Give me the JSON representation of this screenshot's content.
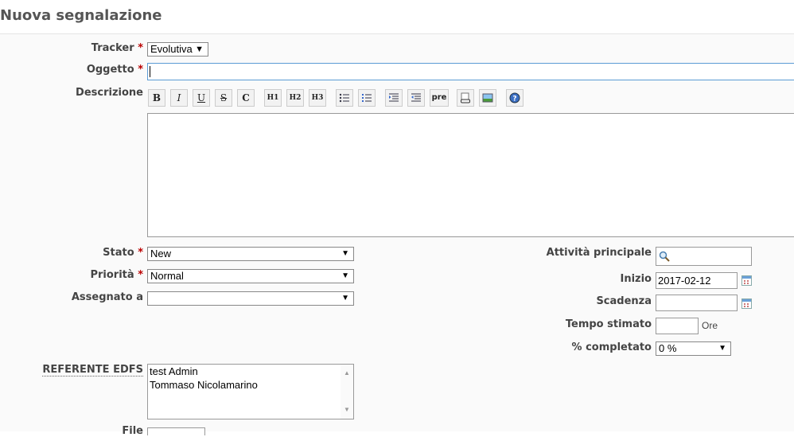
{
  "page": {
    "title": "Nuova segnalazione"
  },
  "form": {
    "tracker": {
      "label": "Tracker",
      "required": "*",
      "value": "Evolutiva"
    },
    "oggetto": {
      "label": "Oggetto",
      "required": "*",
      "value": ""
    },
    "descrizione": {
      "label": "Descrizione",
      "toolbar": [
        "B",
        "I",
        "U",
        "S",
        "C",
        "H1",
        "H2",
        "H3",
        "ul",
        "ol",
        "indent",
        "outdent",
        "pre",
        "link",
        "image",
        "help"
      ],
      "value": ""
    },
    "stato": {
      "label": "Stato",
      "required": "*",
      "value": "New"
    },
    "priorita": {
      "label": "Priorità",
      "required": "*",
      "value": "Normal"
    },
    "assegnato": {
      "label": "Assegnato a",
      "value": ""
    },
    "attivita_principale": {
      "label": "Attività principale",
      "value": ""
    },
    "inizio": {
      "label": "Inizio",
      "value": "2017-02-12"
    },
    "scadenza": {
      "label": "Scadenza",
      "value": ""
    },
    "tempo_stimato": {
      "label": "Tempo stimato",
      "value": "",
      "unit": "Ore"
    },
    "completato": {
      "label": "% completato",
      "value": "0 %"
    },
    "referente": {
      "label": "REFERENTE EDFS",
      "options": [
        "test Admin",
        "Tommaso Nicolamarino"
      ]
    },
    "file": {
      "label": "File"
    }
  }
}
